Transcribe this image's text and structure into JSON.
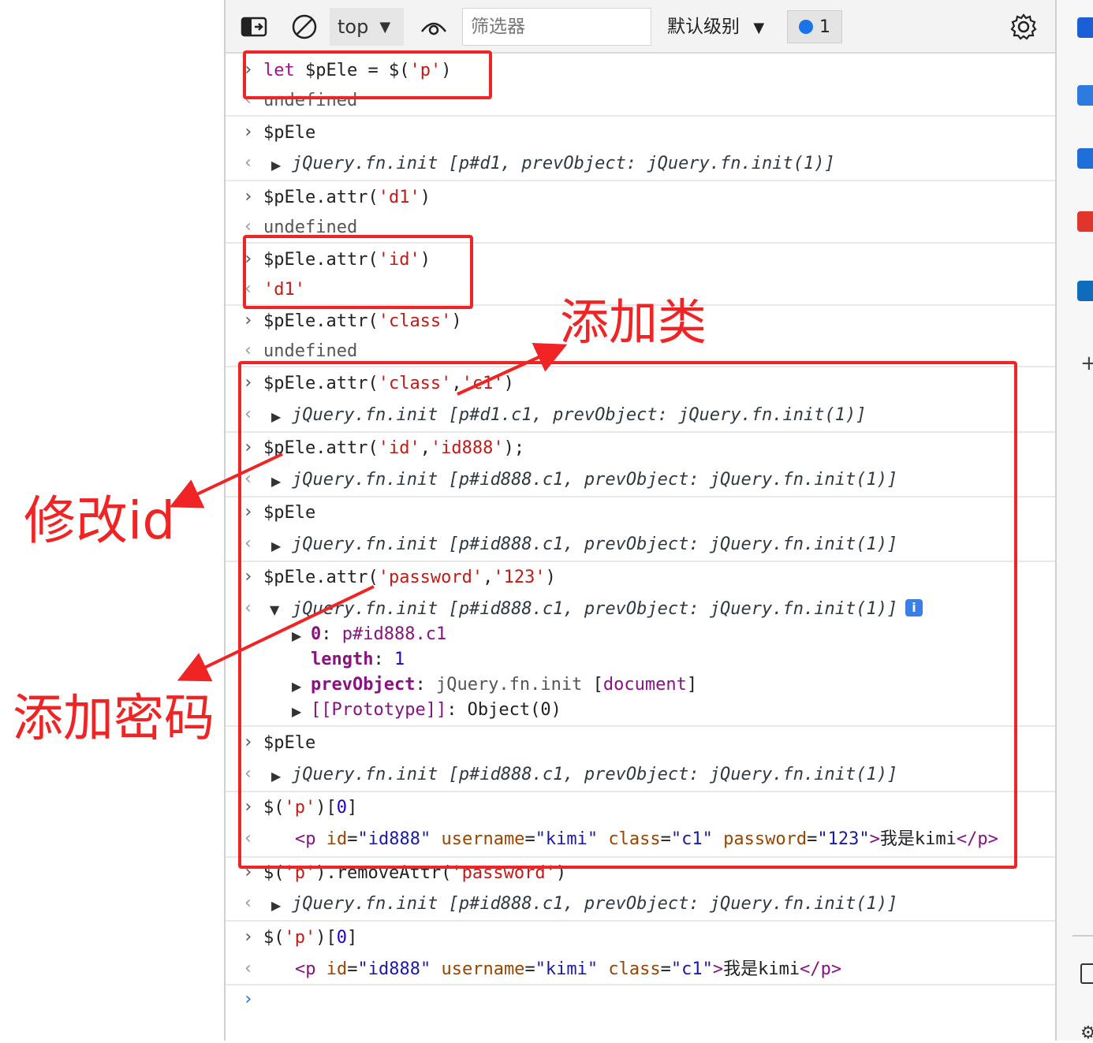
{
  "toolbar": {
    "context": "top",
    "filter_placeholder": "筛选器",
    "level": "默认级别",
    "message_count": "1"
  },
  "console": {
    "prompt": "›",
    "entries": [
      {
        "input": "let $pEle = $('p')",
        "output": "undefined"
      },
      {
        "input": "$pEle",
        "output": "jQuery.fn.init [p#d1, prevObject: jQuery.fn.init(1)]"
      },
      {
        "input": "$pEle.attr('d1')",
        "output": "undefined"
      },
      {
        "input": "$pEle.attr('id')",
        "output": "'d1'"
      },
      {
        "input": "$pEle.attr('class')",
        "output": "undefined"
      },
      {
        "input": "$pEle.attr('class','c1')",
        "output": "jQuery.fn.init [p#d1.c1, prevObject: jQuery.fn.init(1)]"
      },
      {
        "input": "$pEle.attr('id','id888');",
        "output": "jQuery.fn.init [p#id888.c1, prevObject: jQuery.fn.init(1)]"
      },
      {
        "input": "$pEle",
        "output": "jQuery.fn.init [p#id888.c1, prevObject: jQuery.fn.init(1)]"
      },
      {
        "input": "$pEle.attr('password','123')",
        "output": "jQuery.fn.init [p#id888.c1, prevObject: jQuery.fn.init(1)]",
        "expanded": [
          "0: p#id888.c1",
          "length: 1",
          "prevObject: jQuery.fn.init [document]",
          "[[Prototype]]: Object(0)"
        ]
      },
      {
        "input": "$pEle",
        "output": "jQuery.fn.init [p#id888.c1, prevObject: jQuery.fn.init(1)]"
      },
      {
        "input": "$('p')[0]",
        "output": "<p id=\"id888\" username=\"kimi\" class=\"c1\" password=\"123\">我是kimi</p>"
      },
      {
        "input": "$('p').removeAttr('password')",
        "output": "jQuery.fn.init [p#id888.c1, prevObject: jQuery.fn.init(1)]"
      },
      {
        "input": "$('p')[0]",
        "output": "<p id=\"id888\" username=\"kimi\" class=\"c1\">我是kimi</p>"
      }
    ]
  },
  "annotations": {
    "add_class": "添加类",
    "modify_id": "修改id",
    "add_password": "添加密码"
  },
  "colors": {
    "annotation_red": "#f02424",
    "string": "#c41a16",
    "keyword": "#aa0d91"
  }
}
